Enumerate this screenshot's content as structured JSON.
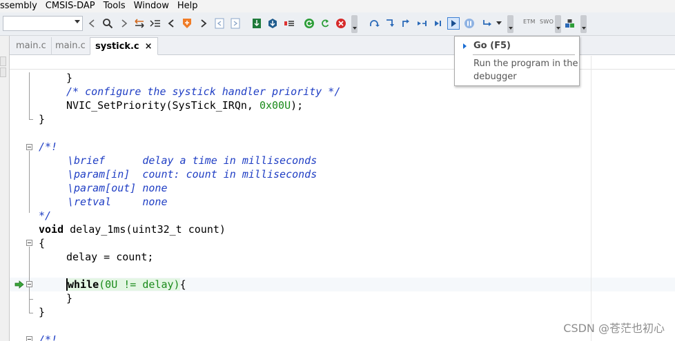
{
  "menu": [
    "ssembly",
    "CMSIS-DAP",
    "Tools",
    "Window",
    "Help"
  ],
  "toolbar": {
    "target_combo_value": "",
    "etm_label": "ETM",
    "swo_label": "SWO",
    "accent_color": "#3c7fd3"
  },
  "tabs": [
    {
      "label": "main.c",
      "active": false
    },
    {
      "label": "main.c",
      "active": false
    },
    {
      "label": "systick.c",
      "active": true,
      "close": "×"
    }
  ],
  "tooltip": {
    "title": "Go (F5)",
    "description": "Run the program in the debugger"
  },
  "code": {
    "line1": "}",
    "line2": "/* configure the systick handler priority */",
    "line3_fn": "NVIC_SetPriority(SysTick_IRQn, ",
    "line3_hex": "0x00U",
    "line3_end": ");",
    "line4": "}",
    "line6": "/*!",
    "line7": "\\brief      delay a time in milliseconds",
    "line8": "\\param[in]  count: count in milliseconds",
    "line9": "\\param[out] none",
    "line10": "\\retval     none",
    "line11": "*/",
    "line12_kw": "void",
    "line12_rest": " delay_1ms(uint32_t count)",
    "line13": "{",
    "line14": "delay = count;",
    "line16_kw": "while",
    "line16_cond": "(0U != delay)",
    "line16_end": "{",
    "line17": "}",
    "line18": "}",
    "line20": "/*!"
  },
  "watermark": "CSDN @苍茫也初心"
}
